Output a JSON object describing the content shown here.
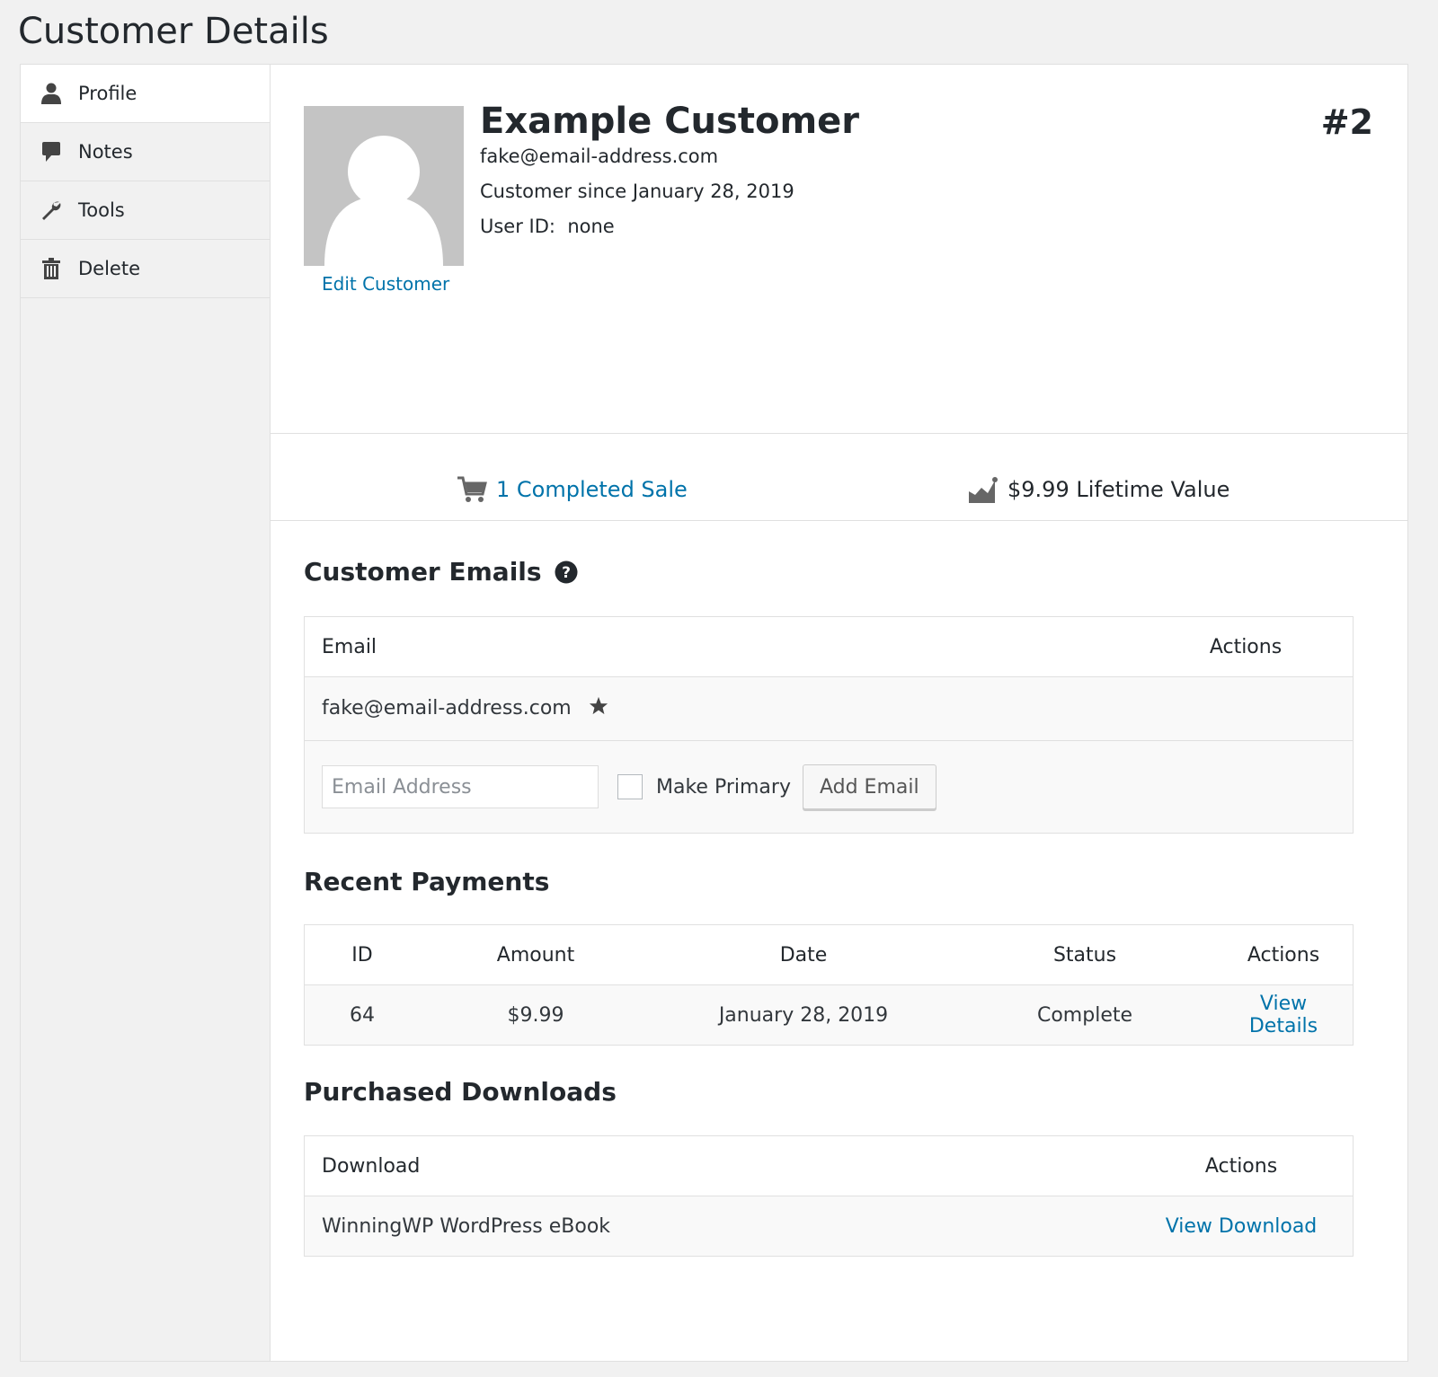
{
  "page": {
    "title": "Customer Details"
  },
  "sidebar": {
    "items": [
      {
        "label": "Profile",
        "icon": "user-icon",
        "active": true
      },
      {
        "label": "Notes",
        "icon": "comment-icon",
        "active": false
      },
      {
        "label": "Tools",
        "icon": "wrench-icon",
        "active": false
      },
      {
        "label": "Delete",
        "icon": "trash-icon",
        "active": false
      }
    ]
  },
  "customer": {
    "name": "Example Customer",
    "email": "fake@email-address.com",
    "since": "Customer since January 28, 2019",
    "user_id": "User ID:  none",
    "id": "#2",
    "edit_label": "Edit Customer"
  },
  "stats": {
    "sales": "1 Completed Sale",
    "lifetime": "$9.99 Lifetime Value"
  },
  "emails": {
    "title": "Customer Emails",
    "headers": {
      "email": "Email",
      "actions": "Actions"
    },
    "rows": [
      {
        "email": "fake@email-address.com",
        "primary": true
      }
    ],
    "input_placeholder": "Email Address",
    "make_primary_label": "Make Primary",
    "add_button": "Add Email"
  },
  "payments": {
    "title": "Recent Payments",
    "headers": [
      "ID",
      "Amount",
      "Date",
      "Status",
      "Actions"
    ],
    "rows": [
      {
        "id": "64",
        "amount": "$9.99",
        "date": "January 28, 2019",
        "status": "Complete",
        "action": "View Details"
      }
    ]
  },
  "downloads": {
    "title": "Purchased Downloads",
    "headers": {
      "download": "Download",
      "actions": "Actions"
    },
    "rows": [
      {
        "download": "WinningWP WordPress eBook",
        "action": "View Download"
      }
    ]
  },
  "colors": {
    "link": "#0073aa",
    "text": "#23282d",
    "background": "#f1f1f1"
  }
}
